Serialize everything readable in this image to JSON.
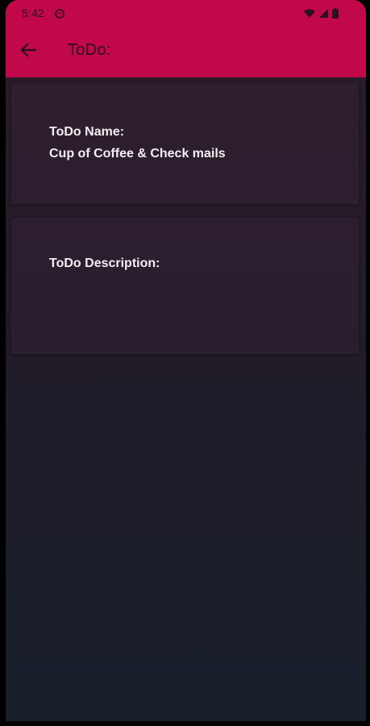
{
  "status_bar": {
    "time": "5:42",
    "icons": [
      "notification-app-icon",
      "wifi-icon",
      "signal-icon",
      "battery-icon"
    ]
  },
  "toolbar": {
    "back_icon": "arrow-left-icon",
    "title": "ToDo:"
  },
  "todo": {
    "name_label": "ToDo Name:",
    "name_value": "Cup of Coffee & Check mails",
    "description_label": "ToDo Description:",
    "description_value": ""
  },
  "colors": {
    "app_bar": "#c0084a",
    "background_top": "#2b1b2a",
    "background_bottom": "#18202c",
    "text": "#f2eef2"
  }
}
